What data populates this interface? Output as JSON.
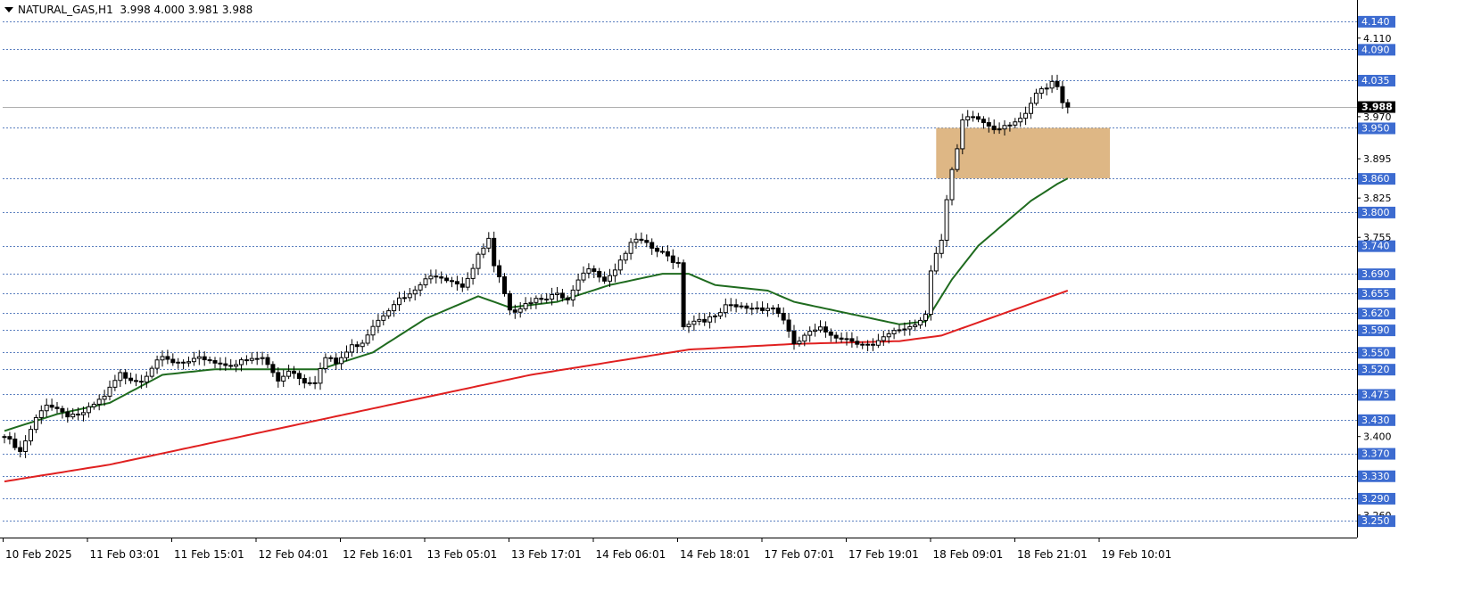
{
  "header": {
    "symbol": "NATURAL_GAS,H1",
    "open": "3.998",
    "high": "4.000",
    "low": "3.981",
    "close": "3.988"
  },
  "colors": {
    "background": "#ffffff",
    "axis": "#000000",
    "grid_level": "#5b7fbf",
    "price_tag_blue": "#3c6bd0",
    "current_price_tag": "#000000",
    "ma_fast": "#1f6b1f",
    "ma_slow": "#e02020",
    "zone": "#d8aa70"
  },
  "chart_data": {
    "type": "candlestick",
    "timeframe": "H1",
    "ylim": [
      3.22,
      4.17
    ],
    "y_ticks": [
      "4.110",
      "3.970",
      "3.895",
      "3.825",
      "3.755",
      "3.686",
      "3.616",
      "3.546",
      "3.400",
      "3.260"
    ],
    "level_tags": [
      "4.140",
      "4.090",
      "4.035",
      "3.950",
      "3.860",
      "3.800",
      "3.740",
      "3.690",
      "3.655",
      "3.620",
      "3.590",
      "3.550",
      "3.520",
      "3.475",
      "3.430",
      "3.370",
      "3.330",
      "3.290",
      "3.250"
    ],
    "current_price": "3.988",
    "x_labels": [
      "10 Feb 2025",
      "11 Feb 03:01",
      "11 Feb 15:01",
      "12 Feb 04:01",
      "12 Feb 16:01",
      "13 Feb 05:01",
      "13 Feb 17:01",
      "14 Feb 06:01",
      "14 Feb 18:01",
      "17 Feb 07:01",
      "17 Feb 19:01",
      "18 Feb 09:01",
      "18 Feb 21:01",
      "19 Feb 10:01"
    ],
    "zone": {
      "top": 3.95,
      "bottom": 3.86,
      "from_bar": 177,
      "to_bar": 210
    },
    "close_anchors": [
      [
        0,
        3.4
      ],
      [
        3,
        3.37
      ],
      [
        6,
        3.43
      ],
      [
        8,
        3.46
      ],
      [
        12,
        3.44
      ],
      [
        15,
        3.44
      ],
      [
        19,
        3.47
      ],
      [
        22,
        3.51
      ],
      [
        26,
        3.5
      ],
      [
        29,
        3.54
      ],
      [
        32,
        3.53
      ],
      [
        35,
        3.53
      ],
      [
        38,
        3.54
      ],
      [
        41,
        3.53
      ],
      [
        44,
        3.53
      ],
      [
        49,
        3.54
      ],
      [
        52,
        3.5
      ],
      [
        54,
        3.52
      ],
      [
        57,
        3.5
      ],
      [
        59,
        3.5
      ],
      [
        61,
        3.54
      ],
      [
        63,
        3.53
      ],
      [
        66,
        3.56
      ],
      [
        68,
        3.57
      ],
      [
        70,
        3.6
      ],
      [
        72,
        3.62
      ],
      [
        74,
        3.64
      ],
      [
        77,
        3.65
      ],
      [
        79,
        3.67
      ],
      [
        82,
        3.69
      ],
      [
        85,
        3.68
      ],
      [
        87,
        3.67
      ],
      [
        89,
        3.7
      ],
      [
        90,
        3.72
      ],
      [
        92,
        3.75
      ],
      [
        93,
        3.7
      ],
      [
        94,
        3.68
      ],
      [
        96,
        3.62
      ],
      [
        99,
        3.64
      ],
      [
        102,
        3.65
      ],
      [
        105,
        3.65
      ],
      [
        107,
        3.64
      ],
      [
        110,
        3.69
      ],
      [
        112,
        3.7
      ],
      [
        114,
        3.68
      ],
      [
        116,
        3.7
      ],
      [
        118,
        3.73
      ],
      [
        120,
        3.75
      ],
      [
        122,
        3.74
      ],
      [
        124,
        3.73
      ],
      [
        126,
        3.72
      ],
      [
        128,
        3.71
      ],
      [
        129,
        3.6
      ],
      [
        132,
        3.61
      ],
      [
        135,
        3.61
      ],
      [
        137,
        3.63
      ],
      [
        140,
        3.63
      ],
      [
        143,
        3.63
      ],
      [
        146,
        3.63
      ],
      [
        148,
        3.61
      ],
      [
        150,
        3.56
      ],
      [
        152,
        3.58
      ],
      [
        155,
        3.59
      ],
      [
        158,
        3.58
      ],
      [
        162,
        3.57
      ],
      [
        165,
        3.56
      ],
      [
        168,
        3.58
      ],
      [
        170,
        3.59
      ],
      [
        173,
        3.6
      ],
      [
        175,
        3.62
      ],
      [
        176,
        3.7
      ],
      [
        177,
        3.73
      ],
      [
        178,
        3.75
      ],
      [
        179,
        3.82
      ],
      [
        180,
        3.87
      ],
      [
        181,
        3.91
      ],
      [
        182,
        3.96
      ],
      [
        184,
        3.97
      ],
      [
        186,
        3.96
      ],
      [
        188,
        3.95
      ],
      [
        191,
        3.96
      ],
      [
        194,
        3.97
      ],
      [
        196,
        4.01
      ],
      [
        198,
        4.02
      ],
      [
        199,
        4.03
      ],
      [
        200,
        4.02
      ],
      [
        201,
        4.0
      ],
      [
        202,
        3.99
      ]
    ],
    "series": [
      {
        "name": "MA fast",
        "anchors": [
          [
            0,
            3.41
          ],
          [
            10,
            3.44
          ],
          [
            20,
            3.46
          ],
          [
            30,
            3.51
          ],
          [
            40,
            3.52
          ],
          [
            50,
            3.52
          ],
          [
            60,
            3.52
          ],
          [
            70,
            3.55
          ],
          [
            80,
            3.61
          ],
          [
            90,
            3.65
          ],
          [
            96,
            3.63
          ],
          [
            105,
            3.64
          ],
          [
            115,
            3.67
          ],
          [
            125,
            3.69
          ],
          [
            130,
            3.69
          ],
          [
            135,
            3.67
          ],
          [
            140,
            3.665
          ],
          [
            145,
            3.66
          ],
          [
            150,
            3.64
          ],
          [
            160,
            3.62
          ],
          [
            170,
            3.6
          ],
          [
            175,
            3.605
          ],
          [
            180,
            3.68
          ],
          [
            185,
            3.74
          ],
          [
            190,
            3.78
          ],
          [
            195,
            3.82
          ],
          [
            200,
            3.85
          ],
          [
            202,
            3.86
          ]
        ]
      },
      {
        "name": "MA slow",
        "anchors": [
          [
            0,
            3.32
          ],
          [
            20,
            3.35
          ],
          [
            40,
            3.39
          ],
          [
            60,
            3.43
          ],
          [
            80,
            3.47
          ],
          [
            100,
            3.51
          ],
          [
            120,
            3.54
          ],
          [
            130,
            3.555
          ],
          [
            150,
            3.565
          ],
          [
            170,
            3.57
          ],
          [
            178,
            3.58
          ],
          [
            190,
            3.62
          ],
          [
            202,
            3.66
          ]
        ]
      }
    ]
  }
}
